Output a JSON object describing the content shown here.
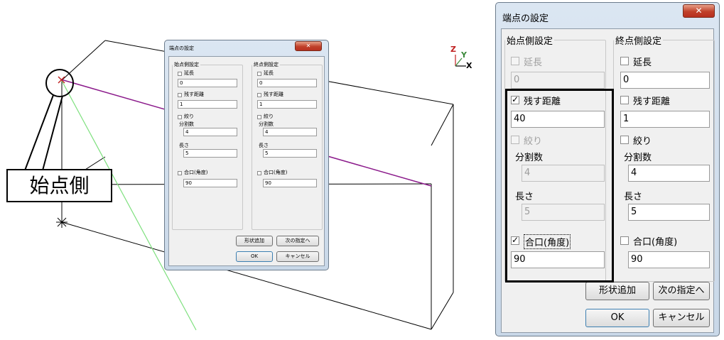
{
  "callout": {
    "text": "始点側"
  },
  "axis": {
    "z": "Z",
    "y": "Y",
    "x": "X"
  },
  "dialog": {
    "title": "端点の設定",
    "close_icon": "close-icon",
    "start_group": {
      "legend": "始点側設定",
      "extend_label": "延長",
      "extend_value": "0",
      "remain_label": "残す距離",
      "remain_value": "40",
      "squeeze_label": "絞り",
      "divisions_label": "分割数",
      "divisions_value": "4",
      "length_label": "長さ",
      "length_value": "5",
      "miter_label": "合口(角度)",
      "miter_value": "90"
    },
    "end_group": {
      "legend": "終点側設定",
      "extend_label": "延長",
      "extend_value": "0",
      "remain_label": "残す距離",
      "remain_value": "1",
      "squeeze_label": "絞り",
      "divisions_label": "分割数",
      "divisions_value": "4",
      "length_label": "長さ",
      "length_value": "5",
      "miter_label": "合口(角度)",
      "miter_value": "90"
    },
    "buttons": {
      "add_shape": "形状追加",
      "next": "次の指定へ",
      "ok": "OK",
      "cancel": "キャンセル"
    }
  },
  "small_dialog": {
    "start_group": {
      "remain_value": "1"
    }
  },
  "colors": {
    "path_line": "#8b1a8b",
    "guide_line": "#7ee07e",
    "axis_x": "#000000",
    "axis_y": "#3b8a3b",
    "axis_z": "#c02020"
  }
}
